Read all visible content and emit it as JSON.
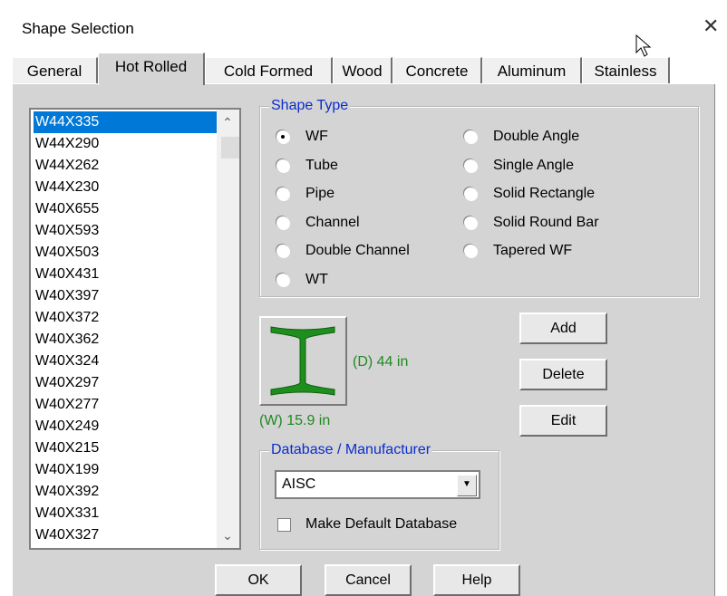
{
  "window": {
    "title": "Shape Selection",
    "close_glyph": "✕"
  },
  "tabs": [
    {
      "label": "General"
    },
    {
      "label": "Hot Rolled",
      "active": true
    },
    {
      "label": "Cold Formed"
    },
    {
      "label": "Wood"
    },
    {
      "label": "Concrete"
    },
    {
      "label": "Aluminum"
    },
    {
      "label": "Stainless"
    }
  ],
  "shape_list": {
    "items": [
      "W44X335",
      "W44X290",
      "W44X262",
      "W44X230",
      "W40X655",
      "W40X593",
      "W40X503",
      "W40X431",
      "W40X397",
      "W40X372",
      "W40X362",
      "W40X324",
      "W40X297",
      "W40X277",
      "W40X249",
      "W40X215",
      "W40X199",
      "W40X392",
      "W40X331",
      "W40X327"
    ],
    "selected": "W44X335"
  },
  "shape_type": {
    "legend": "Shape Type",
    "selected": "WF",
    "options_left": [
      "WF",
      "Tube",
      "Pipe",
      "Channel",
      "Double Channel",
      "WT"
    ],
    "options_right": [
      "Double Angle",
      "Single Angle",
      "Solid Rectangle",
      "Solid Round Bar",
      "Tapered WF"
    ]
  },
  "preview": {
    "depth_label": "(D) 44 in",
    "width_label": "(W) 15.9 in",
    "icon": "wide-flange-icon",
    "shape_color": "#1e8f1e"
  },
  "actions": {
    "add": "Add",
    "delete": "Delete",
    "edit": "Edit"
  },
  "database": {
    "legend": "Database / Manufacturer",
    "value": "AISC",
    "default_checkbox_label": "Make Default Database",
    "default_checked": false
  },
  "footer": {
    "ok": "OK",
    "cancel": "Cancel",
    "help": "Help"
  },
  "colors": {
    "selection": "#0078d7",
    "legend_text": "#0a2ccd",
    "dimension_text": "#1f8a1f"
  }
}
